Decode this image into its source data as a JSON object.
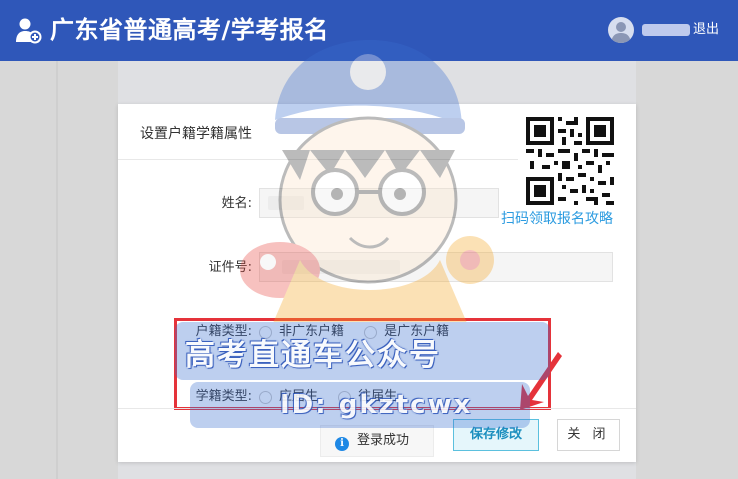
{
  "header": {
    "title": "广东省普通高考/学考报名",
    "logout_label": "退出",
    "logo_icon": "user-add-icon",
    "avatar_icon": "user-avatar-icon"
  },
  "modal": {
    "title": "设置户籍学籍属性",
    "qr_caption": "扫码领取报名攻略",
    "fields": {
      "name_label": "姓名:",
      "id_label": "证件号:"
    },
    "hukou": {
      "label": "户籍类型:",
      "options": [
        "非广东户籍",
        "是广东户籍"
      ]
    },
    "xueji": {
      "label": "学籍类型:",
      "options": [
        "应届生",
        "往届生"
      ]
    },
    "buttons": {
      "save": "保存修改",
      "close": "关 闭"
    },
    "toast": "登录成功"
  },
  "watermark": {
    "banner": "高考直通车公众号",
    "id": "ID: gkztcwx",
    "badge_char": "高",
    "small_char": "高"
  },
  "colors": {
    "header_bg": "#2f57b9",
    "accent_link": "#2b9be0",
    "highlight_red": "#e5333a",
    "save_border": "#5bc0de"
  }
}
